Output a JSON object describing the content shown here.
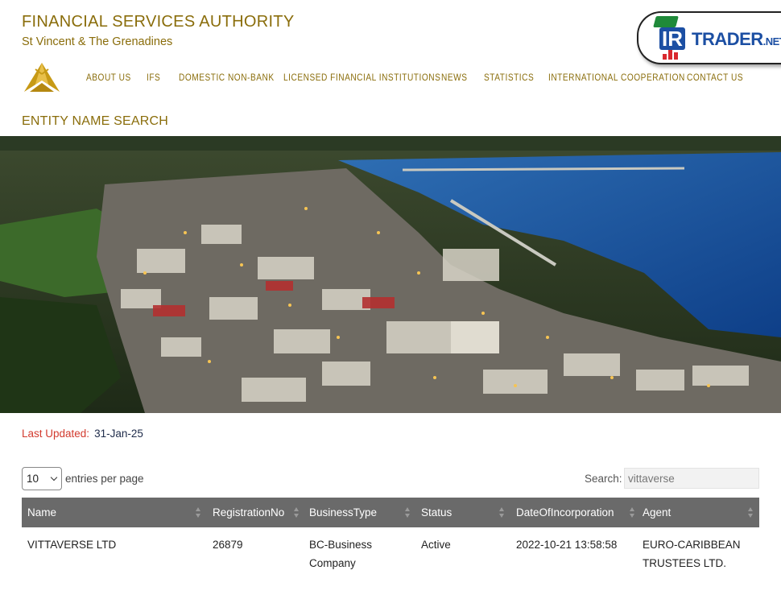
{
  "header": {
    "org_name": "FINANCIAL SERVICES AUTHORITY",
    "org_sub": "St Vincent & The Grenadines"
  },
  "badge": {
    "ir": "IR",
    "trader": "TRADER",
    "net": ".NET"
  },
  "nav": {
    "items": [
      {
        "label": "ABOUT US"
      },
      {
        "label": "IFS"
      },
      {
        "label": "DOMESTIC NON-BANK"
      },
      {
        "label": "LICENSED FINANCIAL INSTITUTIONS"
      },
      {
        "label": "NEWS"
      },
      {
        "label": "STATISTICS"
      },
      {
        "label": "INTERNATIONAL COOPERATION"
      },
      {
        "label": "CONTACT US"
      }
    ]
  },
  "page": {
    "heading": "ENTITY NAME SEARCH",
    "last_updated_label": "Last Updated:",
    "last_updated_date": "31-Jan-25"
  },
  "controls": {
    "entries_value": "10",
    "entries_label": "entries per page",
    "search_label": "Search:",
    "search_value": "vittaverse"
  },
  "table": {
    "headers": [
      "Name",
      "RegistrationNo",
      "BusinessType",
      "Status",
      "DateOfIncorporation",
      "Agent"
    ],
    "rows": [
      {
        "name": "VITTAVERSE LTD",
        "registration_no": "26879",
        "business_type_1": "BC-Business",
        "business_type_2": "Company",
        "status": "Active",
        "date_of_incorporation": "2022-10-21 13:58:58",
        "agent_1": "EURO-CARIBBEAN",
        "agent_2": "TRUSTEES LTD."
      }
    ]
  },
  "colors": {
    "brand_gold": "#8a6d0b",
    "updated_red": "#d23a2e",
    "table_header": "#6a6a6a"
  }
}
